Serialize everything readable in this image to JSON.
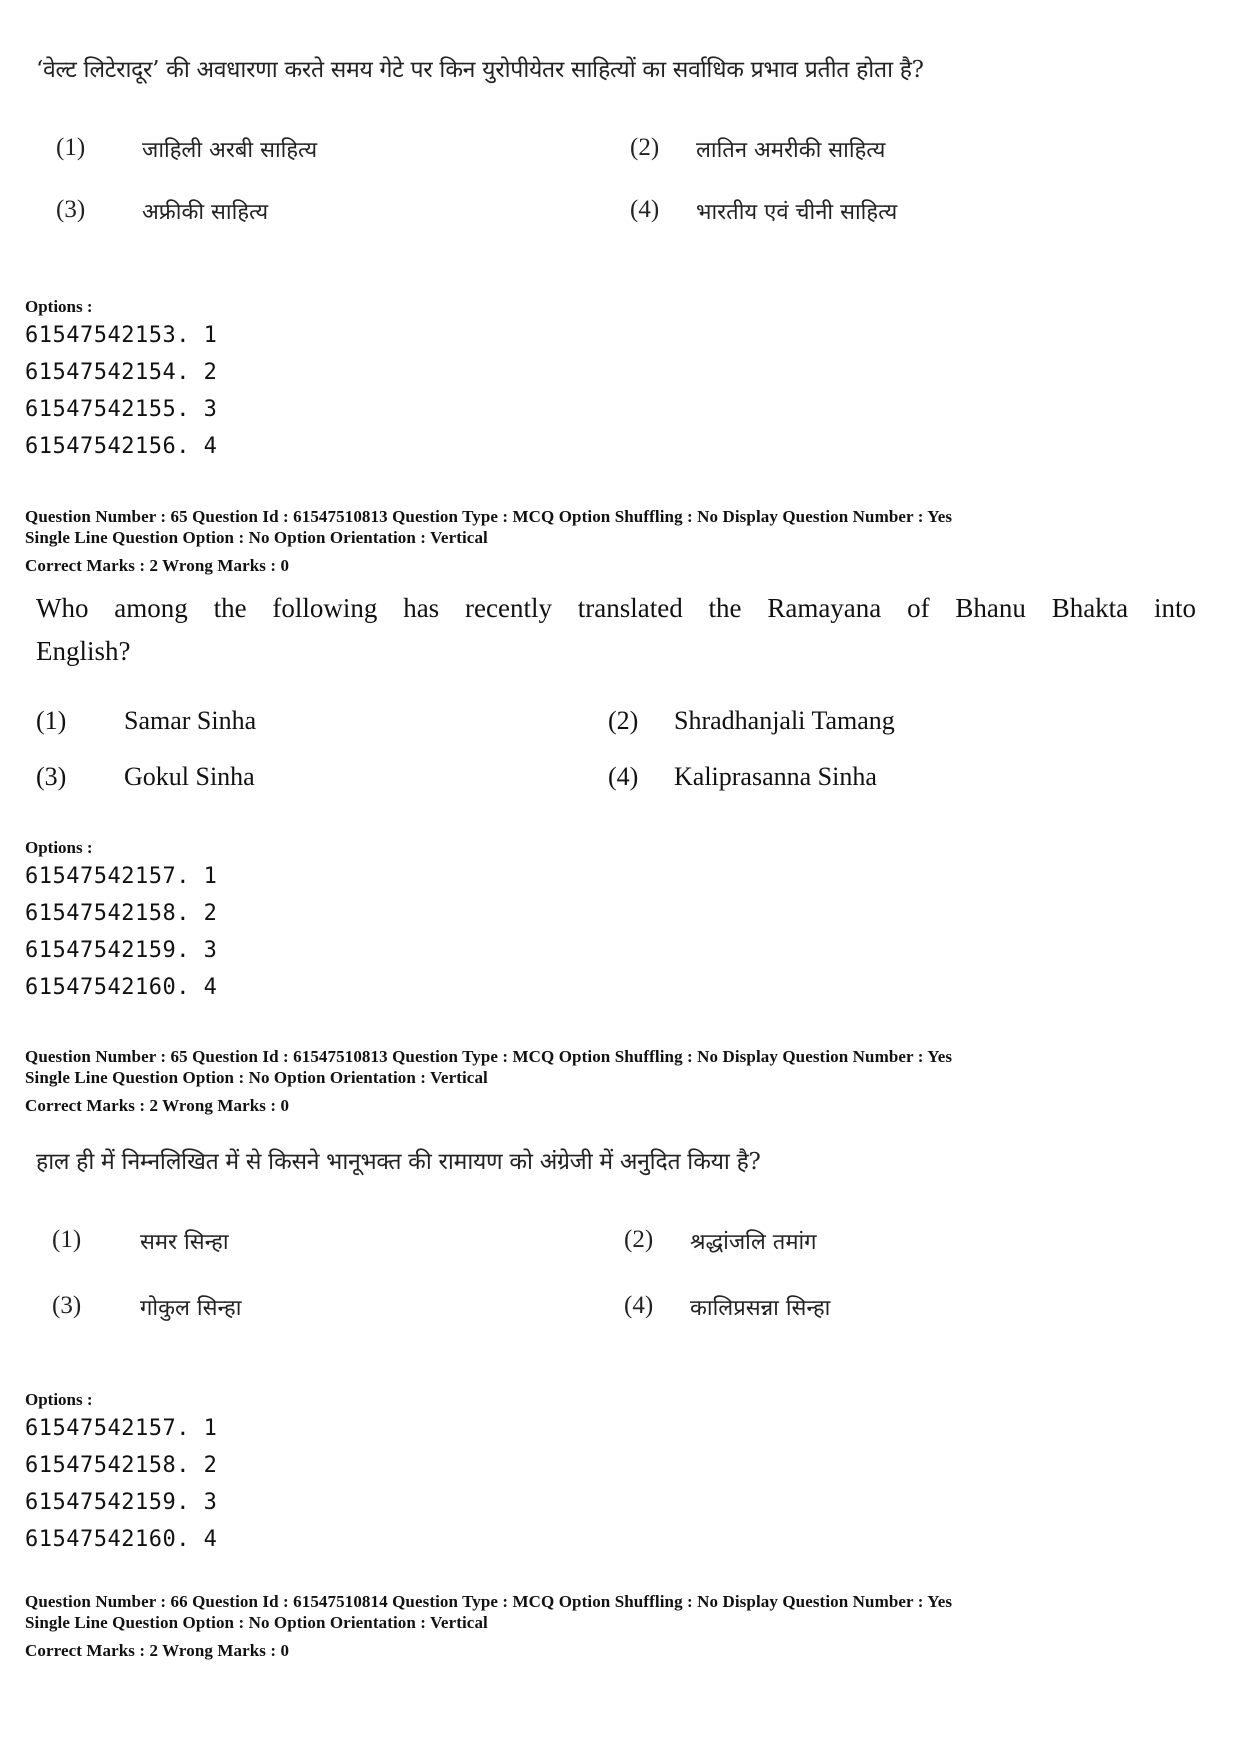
{
  "blocks": [
    {
      "question_text": "‘वेल्ट लिटेरादूर’ की अवधारणा करते समय गेटे पर किन युरोपीयेतर साहित्यों का सर्वाधिक प्रभाव प्रतीत होता है?",
      "choices": [
        {
          "num": "(1)",
          "text": "जाहिली अरबी साहित्य"
        },
        {
          "num": "(2)",
          "text": "लातिन अमरीकी साहित्य"
        },
        {
          "num": "(3)",
          "text": "अफ्रीकी साहित्य"
        },
        {
          "num": "(4)",
          "text": "भारतीय एवं चीनी साहित्य"
        }
      ],
      "options_label": "Options :",
      "option_codes": [
        "61547542153. 1",
        "61547542154. 2",
        "61547542155. 3",
        "61547542156. 4"
      ]
    },
    {
      "meta_line1": "Question Number : 65  Question Id : 61547510813  Question Type : MCQ  Option Shuffling : No  Display Question Number : Yes",
      "meta_line2": "Single Line Question Option : No  Option Orientation : Vertical",
      "marks": "Correct Marks : 2  Wrong Marks : 0",
      "question_line1": "Who among the following has recently translated the Ramayana of Bhanu Bhakta into",
      "question_line2": "English?",
      "choices": [
        {
          "num": "(1)",
          "text": "Samar Sinha"
        },
        {
          "num": "(2)",
          "text": "Shradhanjali Tamang"
        },
        {
          "num": "(3)",
          "text": "Gokul Sinha"
        },
        {
          "num": "(4)",
          "text": "Kaliprasanna Sinha"
        }
      ],
      "options_label": "Options :",
      "option_codes": [
        "61547542157. 1",
        "61547542158. 2",
        "61547542159. 3",
        "61547542160. 4"
      ]
    },
    {
      "meta_line1": "Question Number : 65  Question Id : 61547510813  Question Type : MCQ  Option Shuffling : No  Display Question Number : Yes",
      "meta_line2": "Single Line Question Option : No  Option Orientation : Vertical",
      "marks": "Correct Marks : 2  Wrong Marks : 0",
      "question_text": "हाल ही में निम्नलिखित में से किसने भानूभक्त की रामायण को अंग्रेजी में अनुदित किया है?",
      "choices": [
        {
          "num": "(1)",
          "text": "समर सिन्हा"
        },
        {
          "num": "(2)",
          "text": "श्रद्धांजलि तमांग"
        },
        {
          "num": "(3)",
          "text": "गोकुल सिन्हा"
        },
        {
          "num": "(4)",
          "text": "कालिप्रसन्ना सिन्हा"
        }
      ],
      "options_label": "Options :",
      "option_codes": [
        "61547542157. 1",
        "61547542158. 2",
        "61547542159. 3",
        "61547542160. 4"
      ]
    },
    {
      "meta_line1": "Question Number : 66  Question Id : 61547510814  Question Type : MCQ  Option Shuffling : No  Display Question Number : Yes",
      "meta_line2": "Single Line Question Option : No  Option Orientation : Vertical",
      "marks": "Correct Marks : 2  Wrong Marks : 0"
    }
  ]
}
